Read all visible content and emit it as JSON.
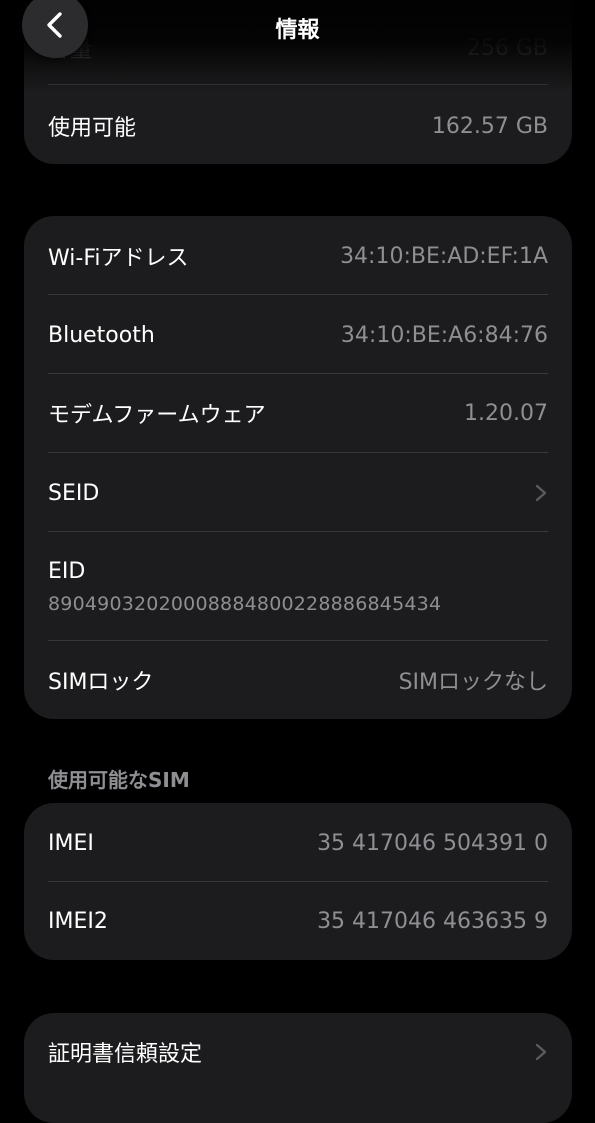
{
  "nav": {
    "title": "情報",
    "back_icon": "chevron-left-icon"
  },
  "storage": {
    "capacity_value": "256 GB",
    "available_label": "使用可能",
    "available_value": "162.57 GB"
  },
  "network": {
    "wifi_label": "Wi-Fiアドレス",
    "wifi_value": "34:10:BE:AD:EF:1A",
    "bluetooth_label": "Bluetooth",
    "bluetooth_value": "34:10:BE:A6:84:76",
    "modem_label": "モデムファームウェア",
    "modem_value": "1.20.07",
    "seid_label": "SEID",
    "eid_label": "EID",
    "eid_value": "89049032020008884800228886845434",
    "simlock_label": "SIMロック",
    "simlock_value": "SIMロックなし"
  },
  "sim_section": {
    "header": "使用可能なSIM",
    "imei_label": "IMEI",
    "imei_value": "35 417046 504391 0",
    "imei2_label": "IMEI2",
    "imei2_value": "35 417046 463635 9"
  },
  "certificate": {
    "label": "証明書信頼設定"
  },
  "colors": {
    "background": "#000000",
    "card": "#1c1c1e",
    "separator": "#38383a",
    "secondary_text": "#8e8e93"
  }
}
